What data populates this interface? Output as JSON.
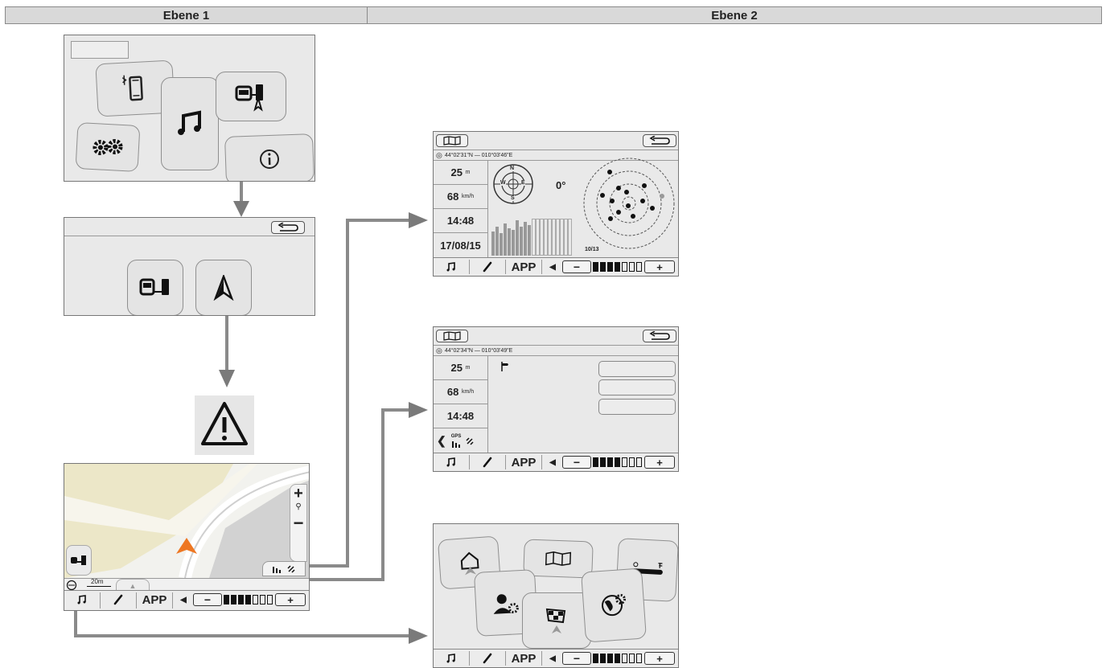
{
  "headers": {
    "col1": "Ebene 1",
    "col2": "Ebene 2"
  },
  "screens": {
    "sat_view": {
      "coords": "44°02'31\"N — 010°03'46\"E",
      "altitude": "25",
      "altitude_unit": "m",
      "speed": "68",
      "speed_unit": "km/h",
      "time": "14:48",
      "date": "17/08/15",
      "heading": "0°",
      "compass": {
        "n": "N",
        "s": "S",
        "e": "E",
        "w": "W"
      },
      "sat_count": "10/13"
    },
    "gps_view": {
      "coords": "44°02'34\"N — 010°03'49\"E",
      "altitude": "25",
      "altitude_unit": "m",
      "speed": "68",
      "speed_unit": "km/h",
      "time": "14:48",
      "gps_label": "GPS"
    },
    "map_view": {
      "scale": "20m"
    }
  },
  "bottom_bar": {
    "app_label": "APP",
    "minus": "−",
    "plus": "+"
  },
  "icons": [
    "phone-bluetooth-icon",
    "music-note-icon",
    "navigation-connect-icon",
    "settings-gears-icon",
    "info-icon",
    "back-arrow-icon",
    "nav-arrow-icon",
    "warning-icon",
    "map-book-icon",
    "home-icon",
    "contacts-settings-icon",
    "destination-flag-icon",
    "globe-settings-icon",
    "slider-icon",
    "satellite-icon",
    "signal-bars-icon"
  ]
}
